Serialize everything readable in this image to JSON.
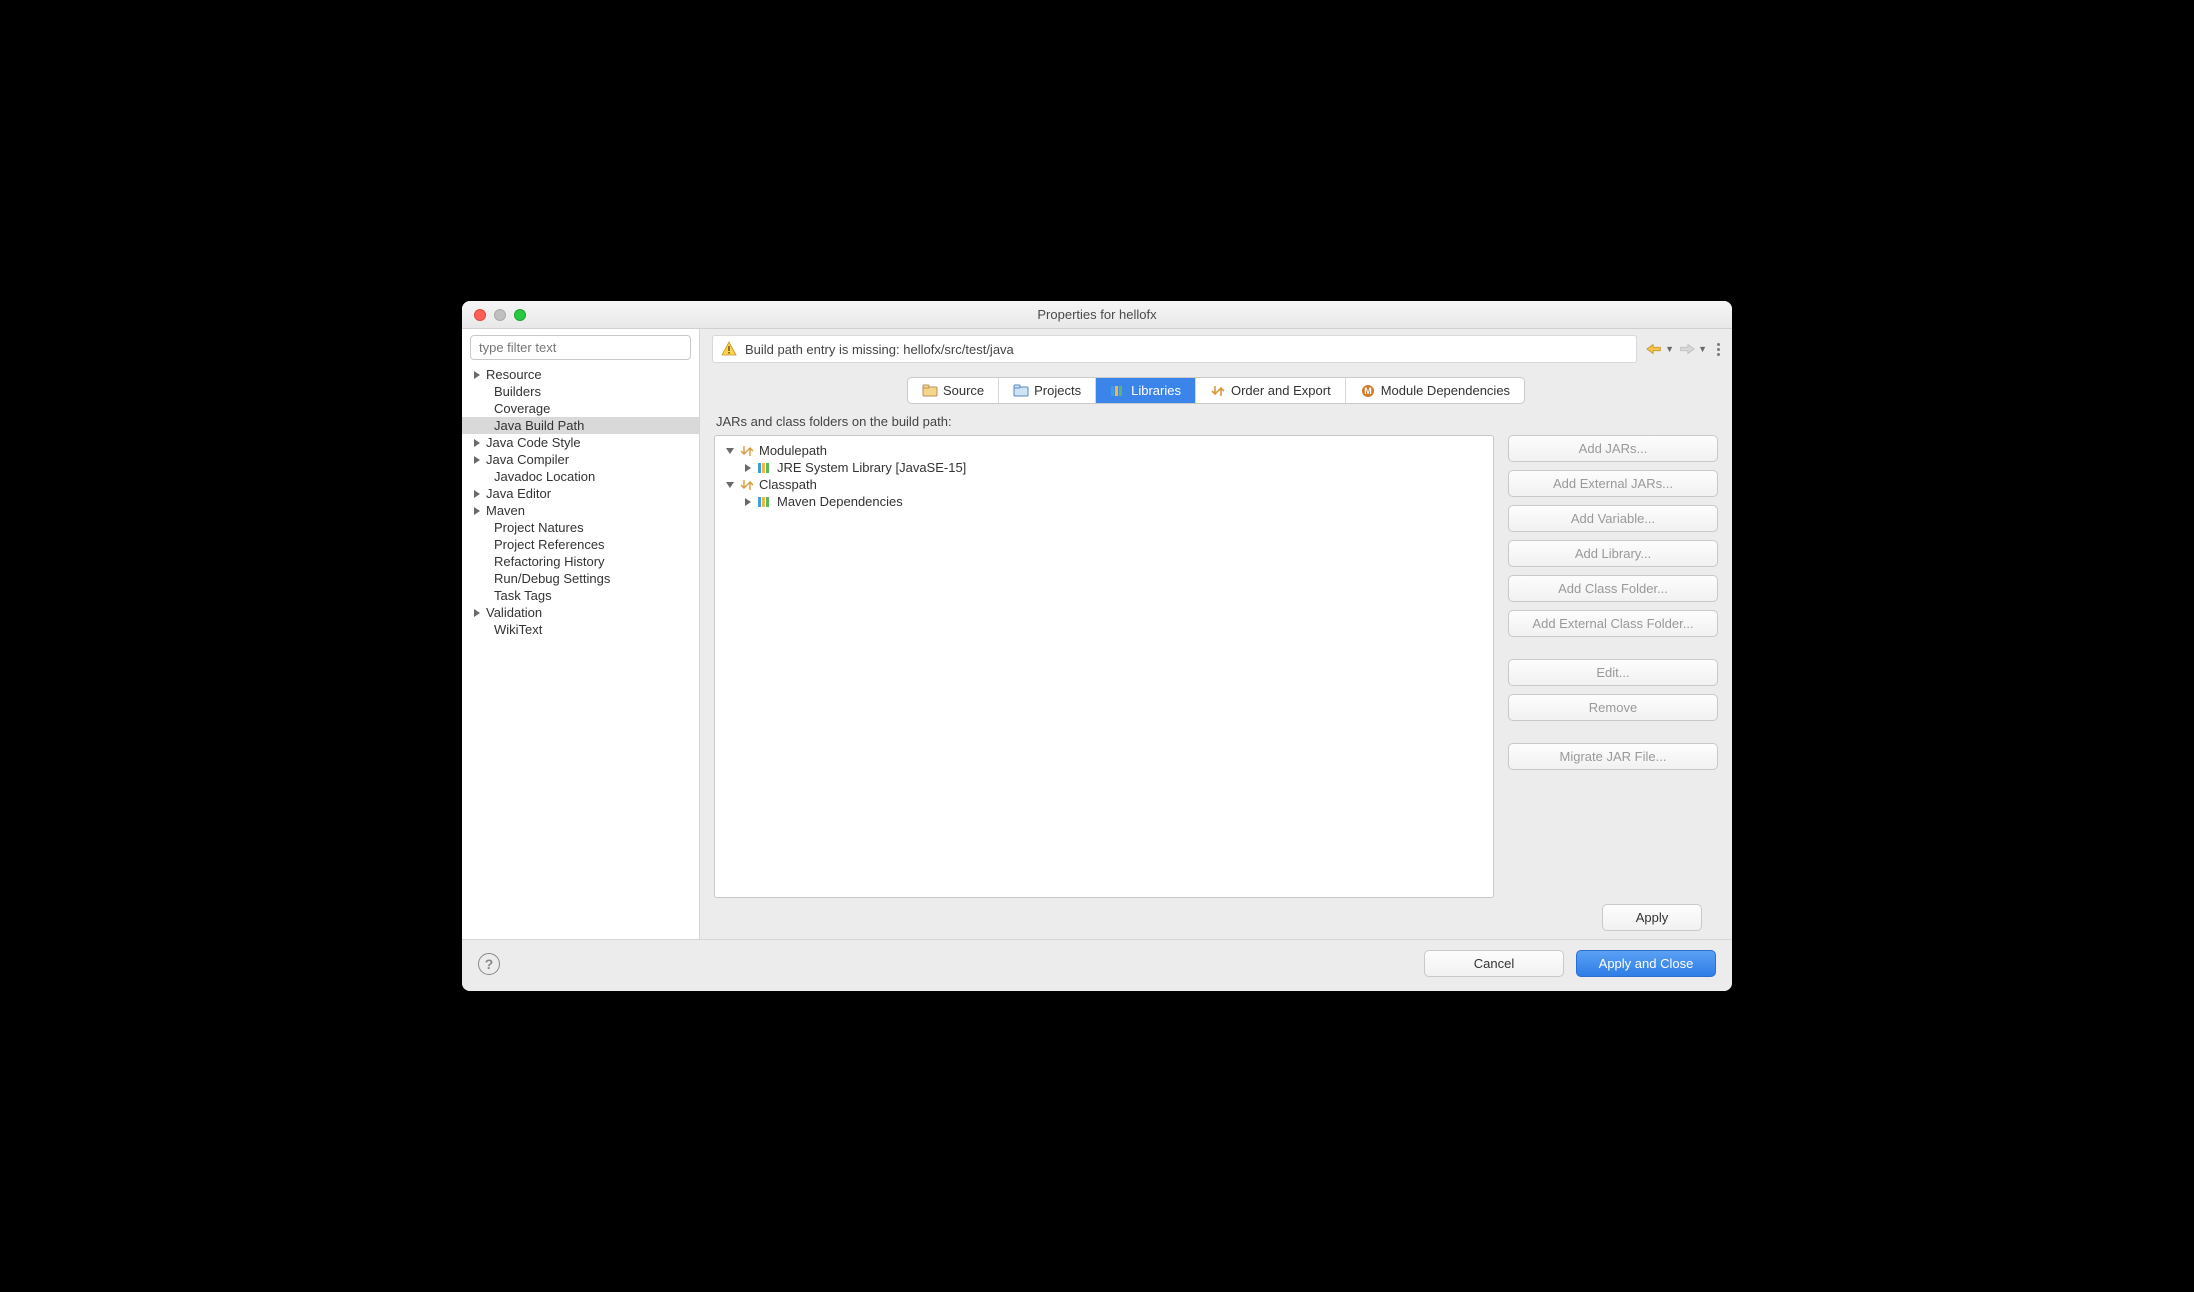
{
  "window": {
    "title": "Properties for hellofx"
  },
  "sidebar": {
    "filter_placeholder": "type filter text",
    "items": [
      {
        "label": "Resource",
        "expandable": true,
        "depth": 0
      },
      {
        "label": "Builders",
        "expandable": false,
        "depth": 1
      },
      {
        "label": "Coverage",
        "expandable": false,
        "depth": 1
      },
      {
        "label": "Java Build Path",
        "expandable": false,
        "depth": 1,
        "selected": true
      },
      {
        "label": "Java Code Style",
        "expandable": true,
        "depth": 0
      },
      {
        "label": "Java Compiler",
        "expandable": true,
        "depth": 0
      },
      {
        "label": "Javadoc Location",
        "expandable": false,
        "depth": 1
      },
      {
        "label": "Java Editor",
        "expandable": true,
        "depth": 0
      },
      {
        "label": "Maven",
        "expandable": true,
        "depth": 0
      },
      {
        "label": "Project Natures",
        "expandable": false,
        "depth": 1
      },
      {
        "label": "Project References",
        "expandable": false,
        "depth": 1
      },
      {
        "label": "Refactoring History",
        "expandable": false,
        "depth": 1
      },
      {
        "label": "Run/Debug Settings",
        "expandable": false,
        "depth": 1
      },
      {
        "label": "Task Tags",
        "expandable": false,
        "depth": 1
      },
      {
        "label": "Validation",
        "expandable": true,
        "depth": 0
      },
      {
        "label": "WikiText",
        "expandable": false,
        "depth": 1
      }
    ]
  },
  "message": {
    "text": "Build path entry is missing: hellofx/src/test/java"
  },
  "tabs": {
    "items": [
      {
        "label": "Source",
        "icon": "source"
      },
      {
        "label": "Projects",
        "icon": "projects"
      },
      {
        "label": "Libraries",
        "icon": "libraries",
        "active": true
      },
      {
        "label": "Order and Export",
        "icon": "order"
      },
      {
        "label": "Module Dependencies",
        "icon": "module"
      }
    ]
  },
  "libraries": {
    "heading": "JARs and class folders on the build path:",
    "tree": [
      {
        "label": "Modulepath",
        "kind": "group",
        "open": true,
        "depth": 0
      },
      {
        "label": "JRE System Library [JavaSE-15]",
        "kind": "lib",
        "open": false,
        "depth": 1
      },
      {
        "label": "Classpath",
        "kind": "group",
        "open": true,
        "depth": 0
      },
      {
        "label": "Maven Dependencies",
        "kind": "lib",
        "open": false,
        "depth": 1
      }
    ]
  },
  "buttons": {
    "add_jars": "Add JARs...",
    "add_ext_jars": "Add External JARs...",
    "add_variable": "Add Variable...",
    "add_library": "Add Library...",
    "add_class_folder": "Add Class Folder...",
    "add_ext_class_folder": "Add External Class Folder...",
    "edit": "Edit...",
    "remove": "Remove",
    "migrate": "Migrate JAR File...",
    "apply": "Apply",
    "cancel": "Cancel",
    "apply_close": "Apply and Close"
  }
}
